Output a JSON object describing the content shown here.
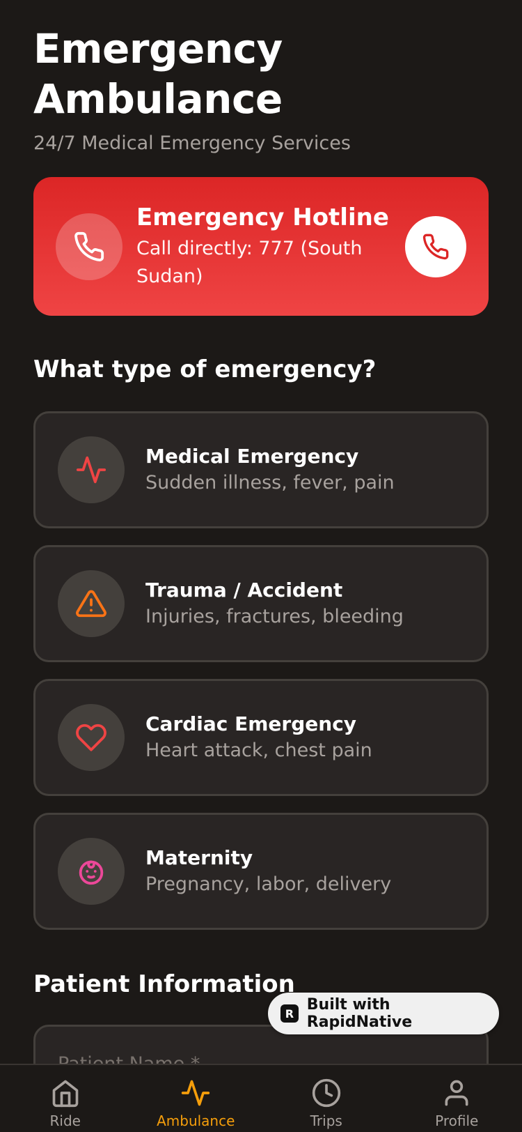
{
  "header": {
    "title_line1": "Emergency",
    "title_line2": "Ambulance",
    "subtitle": "24/7 Medical Emergency Services"
  },
  "hotline": {
    "title": "Emergency Hotline",
    "description": "Call directly: 777 (South Sudan)",
    "icon": "phone-icon"
  },
  "emergency_section": {
    "title": "What type of emergency?",
    "items": [
      {
        "title": "Medical Emergency",
        "description": "Sudden illness, fever, pain",
        "icon": "activity-icon",
        "color": "#ef4444"
      },
      {
        "title": "Trauma / Accident",
        "description": "Injuries, fractures, bleeding",
        "icon": "warning-triangle-icon",
        "color": "#f97316"
      },
      {
        "title": "Cardiac Emergency",
        "description": "Heart attack, chest pain",
        "icon": "heart-icon",
        "color": "#ef4444"
      },
      {
        "title": "Maternity",
        "description": "Pregnancy, labor, delivery",
        "icon": "baby-icon",
        "color": "#ec4899"
      }
    ]
  },
  "patient_section": {
    "title": "Patient Information",
    "name_placeholder": "Patient Name *"
  },
  "badge": {
    "label": "Built with RapidNative"
  },
  "tabs": [
    {
      "label": "Ride",
      "icon": "home-icon",
      "active": false
    },
    {
      "label": "Ambulance",
      "icon": "activity-icon",
      "active": true
    },
    {
      "label": "Trips",
      "icon": "clock-icon",
      "active": false
    },
    {
      "label": "Profile",
      "icon": "user-icon",
      "active": false
    }
  ],
  "colors": {
    "background": "#1c1917",
    "hotline_top": "#dc2626",
    "hotline_bottom": "#ef4444",
    "accent_active_tab": "#f59e0b"
  }
}
